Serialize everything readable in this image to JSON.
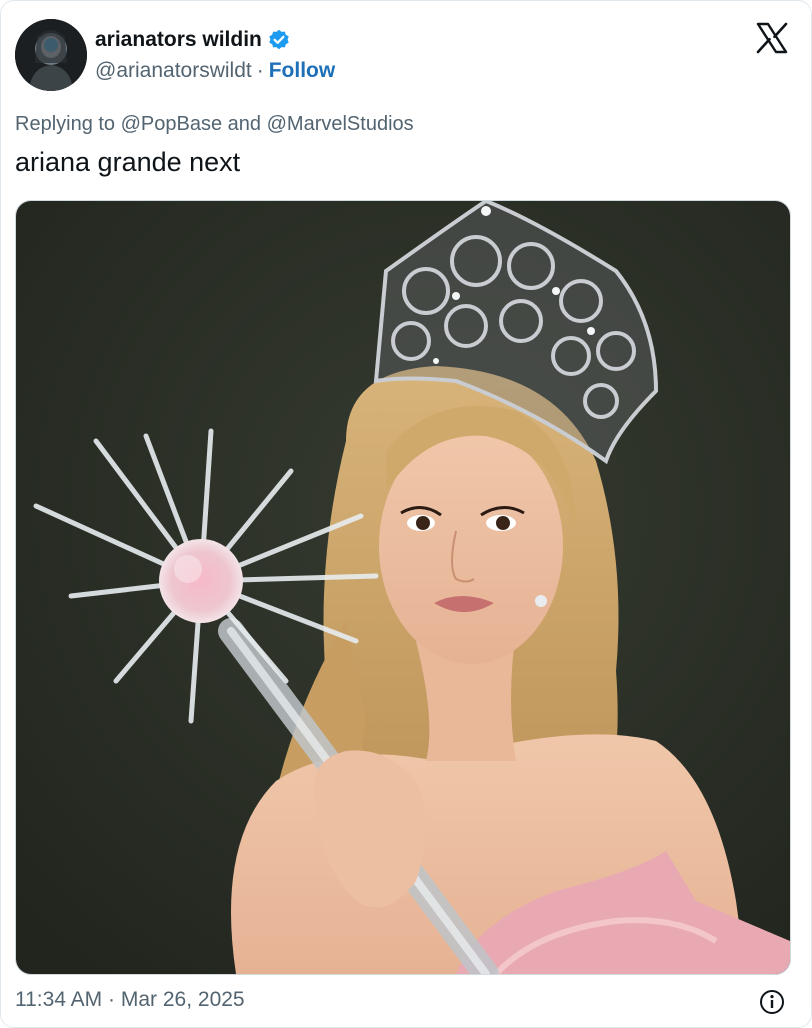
{
  "author": {
    "display_name": "arianators wildin",
    "handle": "@arianatorswildt",
    "separator": "·",
    "follow_label": "Follow"
  },
  "reply": {
    "prefix": "Replying to",
    "mention_1": "@PopBase",
    "conjunction": "and",
    "mention_2": "@MarvelStudios"
  },
  "tweet": {
    "text": "ariana grande next"
  },
  "meta": {
    "time": "11:34 AM",
    "separator": "·",
    "date": "Mar 26, 2025"
  },
  "icons": {
    "verified": "verified-badge-icon",
    "brand": "x-logo-icon",
    "info": "info-icon"
  },
  "colors": {
    "follow_link": "#1d6fb8",
    "verified": "#1d9bf0",
    "secondary_text": "#536471",
    "photo_background": "#2b3026"
  }
}
